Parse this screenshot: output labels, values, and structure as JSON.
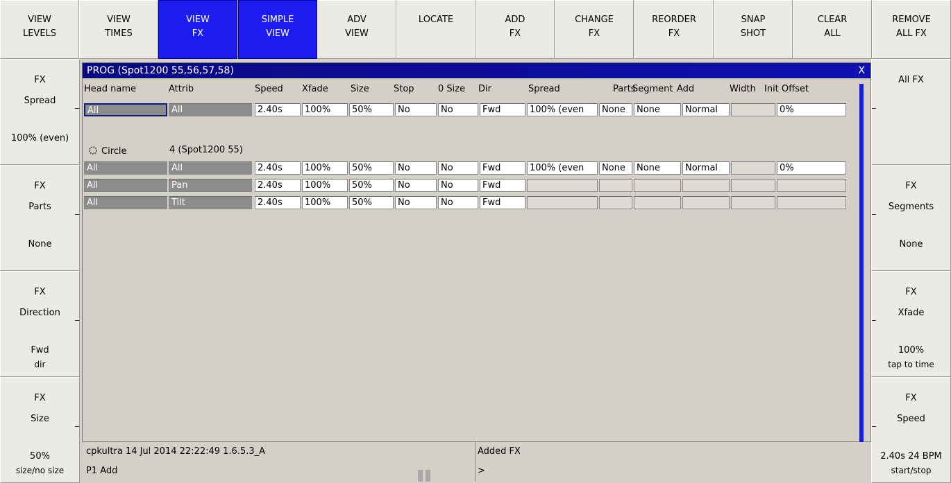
{
  "toolbar": [
    {
      "l1": "VIEW",
      "l2": "LEVELS",
      "active": false
    },
    {
      "l1": "VIEW",
      "l2": "TIMES",
      "active": false
    },
    {
      "l1": "VIEW",
      "l2": "FX",
      "active": true
    },
    {
      "l1": "SIMPLE",
      "l2": "VIEW",
      "active": true
    },
    {
      "l1": "ADV",
      "l2": "VIEW",
      "active": false
    },
    {
      "l1": "LOCATE",
      "l2": "",
      "active": false
    },
    {
      "l1": "ADD",
      "l2": "FX",
      "active": false
    },
    {
      "l1": "CHANGE",
      "l2": "FX",
      "active": false
    },
    {
      "l1": "REORDER",
      "l2": "FX",
      "active": false
    },
    {
      "l1": "SNAP",
      "l2": "SHOT",
      "active": false
    },
    {
      "l1": "CLEAR",
      "l2": "ALL",
      "active": false
    },
    {
      "l1": "REMOVE",
      "l2": "ALL FX",
      "active": false
    }
  ],
  "left": [
    {
      "l1": "FX",
      "l2": "Spread",
      "val": "100% (even)",
      "hint": ""
    },
    {
      "l1": "FX",
      "l2": "Parts",
      "val": "None",
      "hint": ""
    },
    {
      "l1": "FX",
      "l2": "Direction",
      "val": "Fwd",
      "hint": "dir"
    },
    {
      "l1": "FX",
      "l2": "Size",
      "val": "50%",
      "hint": "size/no size"
    }
  ],
  "right": [
    {
      "l1": "All FX",
      "l2": "",
      "val": "",
      "hint": ""
    },
    {
      "l1": "FX",
      "l2": "Segments",
      "val": "None",
      "hint": ""
    },
    {
      "l1": "FX",
      "l2": "Xfade",
      "val": "100%",
      "hint": "tap to time"
    },
    {
      "l1": "FX",
      "l2": "Speed",
      "val": "2.40s  24 BPM",
      "hint": "start/stop"
    }
  ],
  "window": {
    "title": "PROG (Spot1200 55,56,57,58)",
    "close": "X",
    "headers": {
      "head": "Head name",
      "attrib": "Attrib",
      "speed": "Speed",
      "xfade": "Xfade",
      "size": "Size",
      "stop": "Stop",
      "zsize": "0 Size",
      "dir": "Dir",
      "spread": "Spread",
      "parts": "Parts",
      "segment": "Segment",
      "add": "Add",
      "width": "Width",
      "offset": "Init Offset"
    },
    "allrow": [
      "All",
      "All",
      "2.40s",
      "100%",
      "50%",
      "No",
      "No",
      "Fwd",
      "100% (even",
      "None",
      "None",
      "Normal",
      "",
      "0%"
    ],
    "effect_name": "Circle",
    "effect_heads": "4 (Spot1200 55)",
    "rows": [
      [
        "All",
        "All",
        "2.40s",
        "100%",
        "50%",
        "No",
        "No",
        "Fwd",
        "100% (even",
        "None",
        "None",
        "Normal",
        "",
        "0%"
      ],
      [
        "All",
        "Pan",
        "2.40s",
        "100%",
        "50%",
        "No",
        "No",
        "Fwd",
        "",
        "",
        "",
        "",
        "",
        ""
      ],
      [
        "All",
        "Tilt",
        "2.40s",
        "100%",
        "50%",
        "No",
        "No",
        "Fwd",
        "",
        "",
        "",
        "",
        "",
        ""
      ]
    ]
  },
  "status": {
    "info": "cpkultra 14 Jul 2014 22:22:49 1.6.5.3_A",
    "prompt": "P1  Add",
    "message": "Added FX",
    "cmdline": ">"
  }
}
